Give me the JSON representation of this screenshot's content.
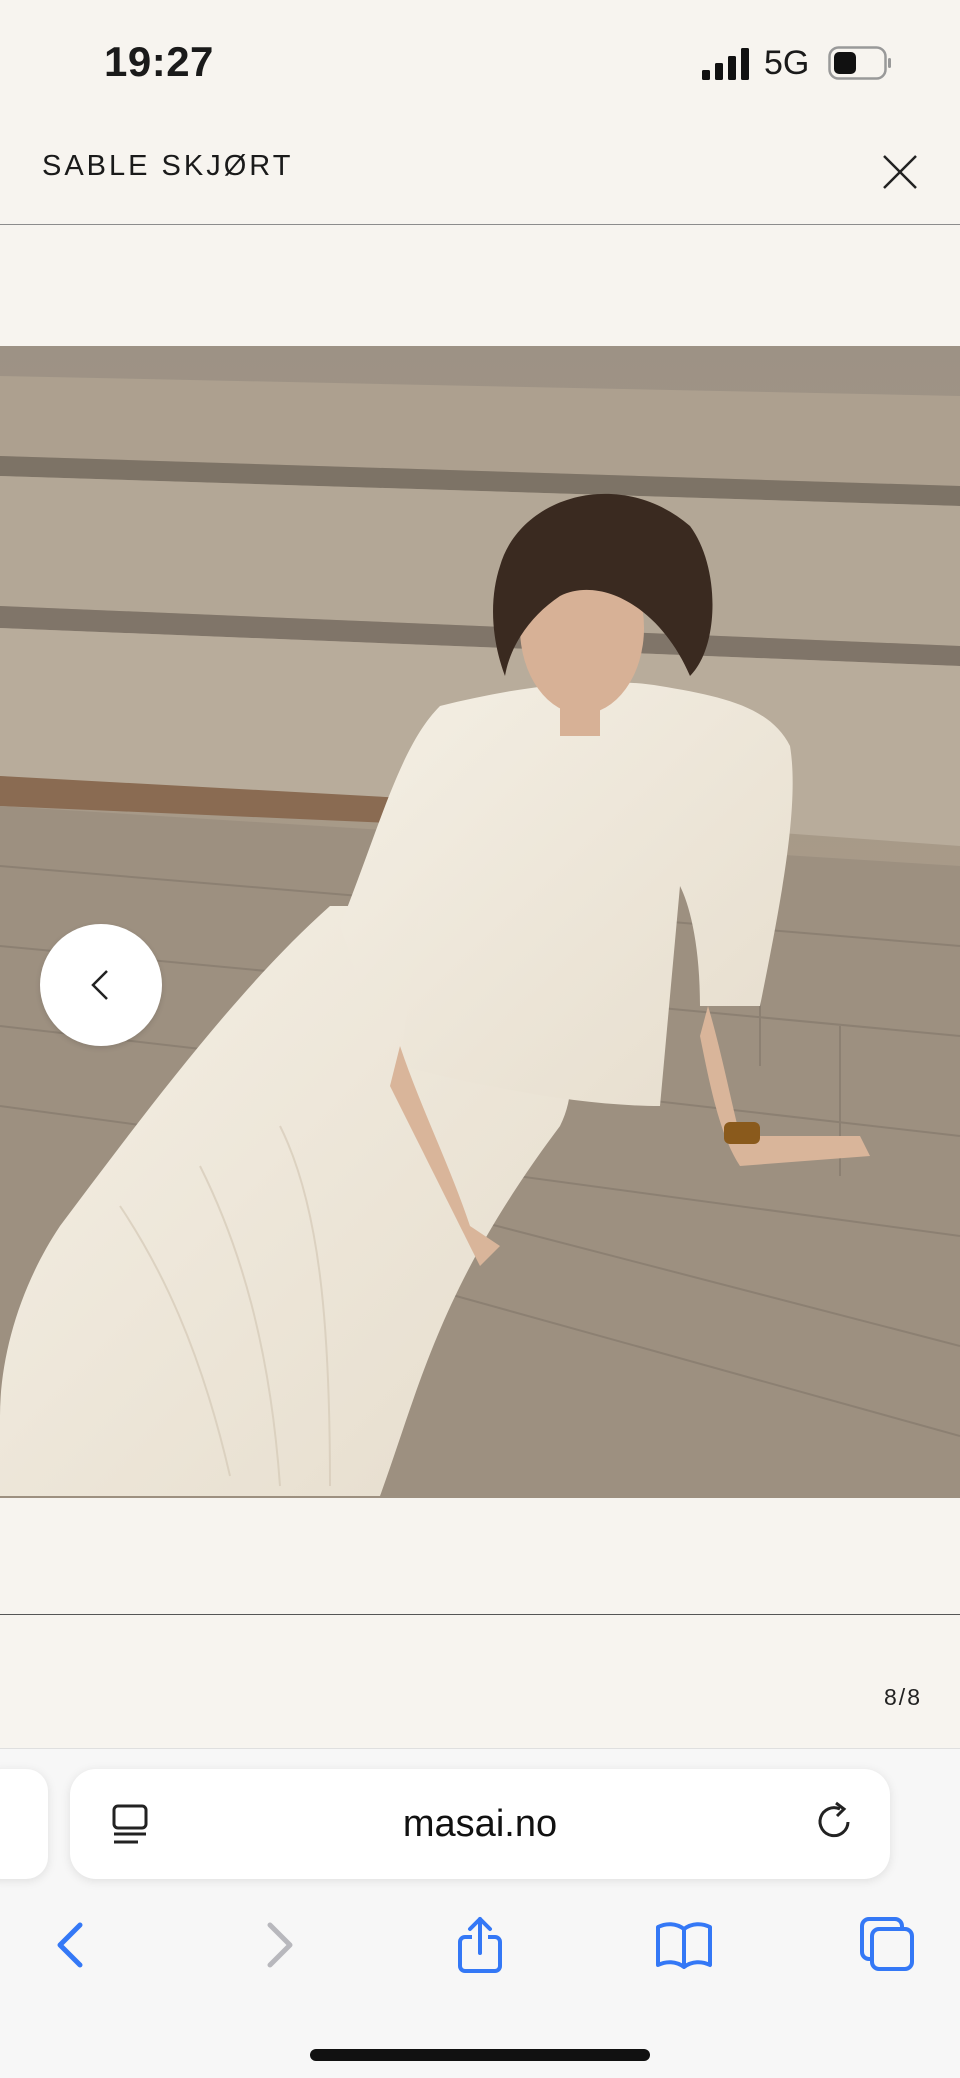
{
  "status_bar": {
    "time": "19:27",
    "network": "5G",
    "icons": [
      "signal-bars-icon",
      "battery-icon"
    ]
  },
  "header": {
    "title": "SABLE SKJØRT",
    "close_icon": "close-icon"
  },
  "gallery": {
    "prev_icon": "chevron-left-icon",
    "counter": "8/8"
  },
  "browser": {
    "url": "masai.no",
    "icons": [
      "reader-mode-icon",
      "reload-icon"
    ],
    "toolbar": [
      "back-icon",
      "forward-icon",
      "share-icon",
      "bookmarks-icon",
      "tabs-icon"
    ],
    "accent_color": "#3478f6"
  }
}
